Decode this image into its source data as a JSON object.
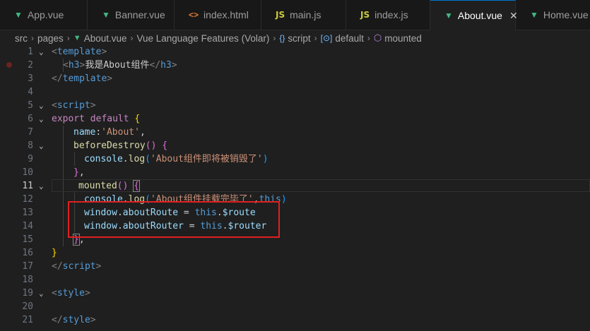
{
  "tabs": [
    {
      "label": "App.vue",
      "icon": "vue-icon"
    },
    {
      "label": "Banner.vue",
      "icon": "vue-icon"
    },
    {
      "label": "index.html",
      "icon": "html-icon"
    },
    {
      "label": "main.js",
      "icon": "js-icon"
    },
    {
      "label": "index.js",
      "icon": "js-icon"
    },
    {
      "label": "About.vue",
      "icon": "vue-icon",
      "active": true
    },
    {
      "label": "Home.vue",
      "icon": "vue-icon"
    }
  ],
  "tab_icons": {
    "vue": "▼",
    "js": "JS",
    "html": "<>",
    "close": "✕"
  },
  "breadcrumb": {
    "src": "src",
    "pages": "pages",
    "file": "About.vue",
    "feature": "Vue Language Features (Volar)",
    "script": "script",
    "default": "default",
    "mounted": "mounted",
    "script_icon": "{}",
    "default_icon": "[⊙]",
    "mounted_icon": "⬡",
    "sep": "›"
  },
  "editor": {
    "current_line": 11,
    "line_numbers": [
      "1",
      "2",
      "3",
      "4",
      "5",
      "6",
      "7",
      "8",
      "9",
      "10",
      "11",
      "12",
      "13",
      "14",
      "15",
      "16",
      "17",
      "18",
      "19",
      "20",
      "21"
    ],
    "code": {
      "l1_open": "<",
      "l1_tag": "template",
      "l1_close": ">",
      "l2_open": "<",
      "l2_tag": "h3",
      "l2_close": ">",
      "l2_text": "我是About组件",
      "l2_eopen": "</",
      "l2_etag": "h3",
      "l2_eclose": ">",
      "l3_open": "</",
      "l3_tag": "template",
      "l3_close": ">",
      "l5_open": "<",
      "l5_tag": "script",
      "l5_close": ">",
      "l6_export": "export",
      "l6_default": "default",
      "l6_brace": "{",
      "l7_name": "name",
      "l7_colon": ":",
      "l7_str": "'About'",
      "l7_comma": ",",
      "l8_fn": "beforeDestroy",
      "l8_paren": "()",
      "l8_brace": "{",
      "l9_obj": "console",
      "l9_dot": ".",
      "l9_fn": "log",
      "l9_p1": "(",
      "l9_str": "'About组件即将被销毁了'",
      "l9_p2": ")",
      "l10_brace": "}",
      "l10_comma": ",",
      "l11_fn": "mounted",
      "l11_paren": "()",
      "l11_brace": "{",
      "l12_obj": "console",
      "l12_dot": ".",
      "l12_fn": "log",
      "l12_p1": "(",
      "l12_str": "'About组件挂载完毕了'",
      "l12_comma": ",",
      "l12_this": "this",
      "l12_p2": ")",
      "l13_obj": "window",
      "l13_dot": ".",
      "l13_prop": "aboutRoute",
      "l13_eq": " = ",
      "l13_this": "this",
      "l13_dot2": ".",
      "l13_val": "$route",
      "l14_obj": "window",
      "l14_dot": ".",
      "l14_prop": "aboutRouter",
      "l14_eq": " = ",
      "l14_this": "this",
      "l14_dot2": ".",
      "l14_val": "$router",
      "l15_brace": "}",
      "l15_comma": ",",
      "l16_brace": "}",
      "l17_open": "</",
      "l17_tag": "script",
      "l17_close": ">",
      "l19_open": "<",
      "l19_tag": "style",
      "l19_close": ">",
      "l21_open": "</",
      "l21_tag": "style",
      "l21_close": ">"
    }
  },
  "fold_chevron": "⌄"
}
